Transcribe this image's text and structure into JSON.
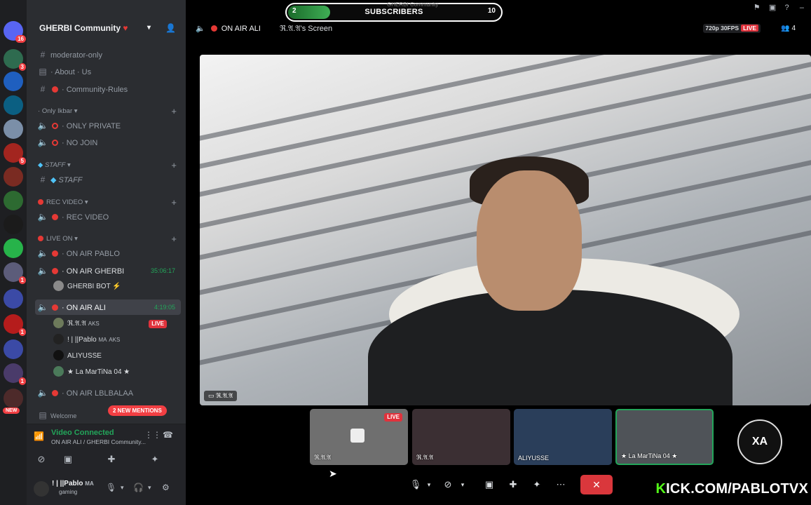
{
  "server_rail": {
    "badges": [
      "16",
      "3",
      "5",
      "1",
      "1",
      "1"
    ],
    "new_label": "NEW"
  },
  "guild": {
    "name": "GHERBI Community",
    "heart": "♥"
  },
  "channels": {
    "moderator": "moderator-only",
    "about": "· About · Us",
    "rules": "· Community-Rules",
    "cat_ikbar": "Only Ikbar",
    "private": "· ONLY PRIVATE",
    "nojoin": "· NO JOIN",
    "cat_staff": "STAFF",
    "staff": "STAFF",
    "cat_rec": "REC VIDEO",
    "rec": "· REC VIDEO",
    "cat_live": "LIVE ON",
    "pablo": "· ON AIR PABLO",
    "gherbi": "· ON AIR GHERBI",
    "gherbi_time": "35:06:17",
    "gherbi_bot": "GHERBI BOT",
    "ali": "· ON AIR ALI",
    "ali_time": "4:19:05",
    "lblbalaa": "· ON AIR LBLBALAA",
    "welcome": "Welcome"
  },
  "voice_users": [
    {
      "name": "ℜ.𝔄.𝔄",
      "tag": "AKS",
      "live": "LIVE"
    },
    {
      "name": "! | ||Pablo",
      "tag": "MA",
      "tag2": "AKS"
    },
    {
      "name": "ALIYUSSE"
    },
    {
      "name": "★ La MarTiNa 04 ★"
    }
  ],
  "mentions": "2 NEW MENTIONS",
  "voice_connection": {
    "title": "Video Connected",
    "subtitle": "ON AIR ALI / GHERBI Community..."
  },
  "current_user": {
    "name": "! | ||Pablo",
    "tag": "MA",
    "status": "gaming"
  },
  "topbar": {
    "channel": "ON AIR ALI",
    "screen": "ℜ.𝔄.𝔄's Screen",
    "quality": "720p 30FPS",
    "live": "LIVE",
    "count": "4"
  },
  "subscribers": {
    "label": "SUBSCRIBERS",
    "low": "2",
    "high": "10",
    "ghost": "GHERBI Community",
    "progress": 0.2
  },
  "video": {
    "label": "ℜ.𝔄.𝔄"
  },
  "thumbnails": [
    {
      "label": "ℜ.𝔄.𝔄",
      "live": "LIVE"
    },
    {
      "label": "ℜ.𝔄.𝔄"
    },
    {
      "label": "ALIYUSSE"
    },
    {
      "label": "★ La MarTiNa 04 ★"
    }
  ],
  "kick": {
    "prefix": "K",
    "rest": "ICK.COM/PABLOTVX"
  },
  "logo_text": "XA",
  "colors": {
    "accent_green": "#23a55a",
    "live_red": "#e0323c",
    "kick_green": "#53fc18"
  }
}
